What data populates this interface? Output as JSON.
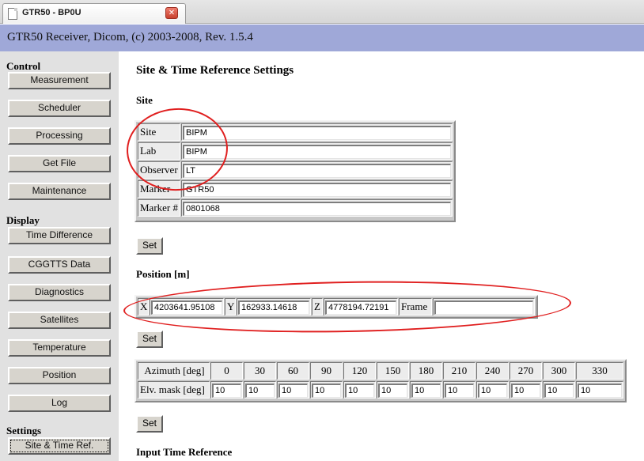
{
  "browser": {
    "tab_title": "GTR50 - BP0U",
    "close_glyph": "✕"
  },
  "header": {
    "title": "GTR50 Receiver, Dicom, (c) 2003-2008, Rev. 1.5.4"
  },
  "sidebar": {
    "control_heading": "Control",
    "control_items": [
      "Measurement",
      "Scheduler",
      "Processing",
      "Get File",
      "Maintenance"
    ],
    "display_heading": "Display",
    "display_items": [
      "Time Difference",
      "CGGTTS Data",
      "Diagnostics",
      "Satellites",
      "Temperature",
      "Position",
      "Log"
    ],
    "settings_heading": "Settings",
    "settings_items": [
      "Site & Time Ref."
    ]
  },
  "main": {
    "page_title": "Site & Time Reference Settings",
    "site": {
      "heading": "Site",
      "rows": [
        {
          "label": "Site",
          "value": "BIPM"
        },
        {
          "label": "Lab",
          "value": "BIPM"
        },
        {
          "label": "Observer",
          "value": "LT"
        },
        {
          "label": "Marker",
          "value": "GTR50"
        },
        {
          "label": "Marker #",
          "value": "0801068"
        }
      ],
      "set_label": "Set"
    },
    "position": {
      "heading": "Position [m]",
      "x_label": "X",
      "x_value": "4203641.95108",
      "y_label": "Y",
      "y_value": "162933.14618",
      "z_label": "Z",
      "z_value": "4778194.72191",
      "frame_label": "Frame",
      "frame_value": "",
      "set_label": "Set"
    },
    "elevation": {
      "azimuth_label": "Azimuth [deg]",
      "mask_label": "Elv. mask [deg]",
      "azimuths": [
        "0",
        "30",
        "60",
        "90",
        "120",
        "150",
        "180",
        "210",
        "240",
        "270",
        "300",
        "330"
      ],
      "masks": [
        "10",
        "10",
        "10",
        "10",
        "10",
        "10",
        "10",
        "10",
        "10",
        "10",
        "10",
        "10"
      ],
      "set_label": "Set"
    },
    "input_time_reference": {
      "heading": "Input Time Reference"
    }
  },
  "colors": {
    "header_bg": "#9fa8d8",
    "annotation": "#e01f1f",
    "sidebar_bg": "#e1e1e1"
  }
}
